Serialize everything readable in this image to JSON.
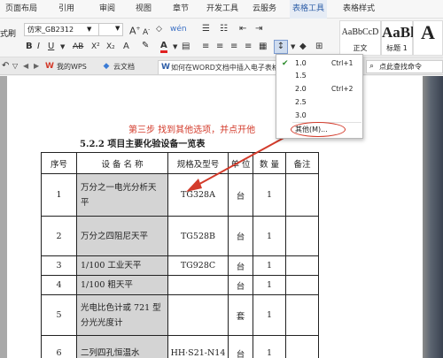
{
  "menu": {
    "tabs": [
      "页面布局",
      "引用",
      "审阅",
      "视图",
      "章节",
      "开发工具",
      "云服务",
      "表格工具",
      "表格样式"
    ],
    "active_tab": "表格工具"
  },
  "ribbon": {
    "left_label": "式刷",
    "font_name": "仿宋_GB2312",
    "font_color_letter": "A",
    "styles": [
      {
        "preview": "AaBbCcD",
        "label": "正文"
      },
      {
        "preview": "AaBl",
        "label": "标题 1"
      },
      {
        "preview": "A",
        "label": ""
      }
    ]
  },
  "tabbar": {
    "tabs": [
      {
        "label": "我的WPS",
        "icon": "wps-logo-icon"
      },
      {
        "label": "云文档",
        "icon": "cloud-doc-icon"
      },
      {
        "label": "如何在WORD文档中插入电子表格",
        "icon": "word-doc-icon"
      }
    ],
    "search_placeholder": "点此查找命令"
  },
  "document": {
    "hint": "第三步 找到其他选项，并点开他",
    "section_title": "5.2.2 项目主要化验设备一览表",
    "table": {
      "headers": [
        "序号",
        "设 备 名 称",
        "规格及型号",
        "单 位",
        "数 量",
        "备注"
      ],
      "rows": [
        {
          "no": "1",
          "name": "万分之一电光分析天平",
          "model": "TG328A",
          "unit": "台",
          "qty": "1",
          "note": ""
        },
        {
          "no": "2",
          "name": "万分之四阻尼天平",
          "model": "TG528B",
          "unit": "台",
          "qty": "1",
          "note": ""
        },
        {
          "no": "3",
          "name": "1/100 工业天平",
          "model": "TG928C",
          "unit": "台",
          "qty": "1",
          "note": ""
        },
        {
          "no": "4",
          "name": "1/100  粗天平",
          "model": "",
          "unit": "台",
          "qty": "1",
          "note": ""
        },
        {
          "no": "5",
          "name": "光电比色计或 721 型分光光度计",
          "model": "",
          "unit": "套",
          "qty": "1",
          "note": ""
        },
        {
          "no": "6",
          "name": "二列四孔恒温水",
          "model": "HH·S21-N14",
          "unit": "台",
          "qty": "1",
          "note": ""
        }
      ]
    }
  },
  "line_spacing_menu": {
    "items": [
      {
        "value": "1.0",
        "shortcut": "Ctrl+1",
        "checked": true
      },
      {
        "value": "1.5",
        "shortcut": "",
        "checked": false
      },
      {
        "value": "2.0",
        "shortcut": "Ctrl+2",
        "checked": false
      },
      {
        "value": "2.5",
        "shortcut": "",
        "checked": false
      },
      {
        "value": "3.0",
        "shortcut": "",
        "checked": false
      }
    ],
    "other": "其他(M)..."
  },
  "colors": {
    "accent": "#2f5fa8",
    "annotation": "#d33b2b",
    "font_color_bar": "#e02020",
    "table_shade": "#d4d4d4"
  }
}
